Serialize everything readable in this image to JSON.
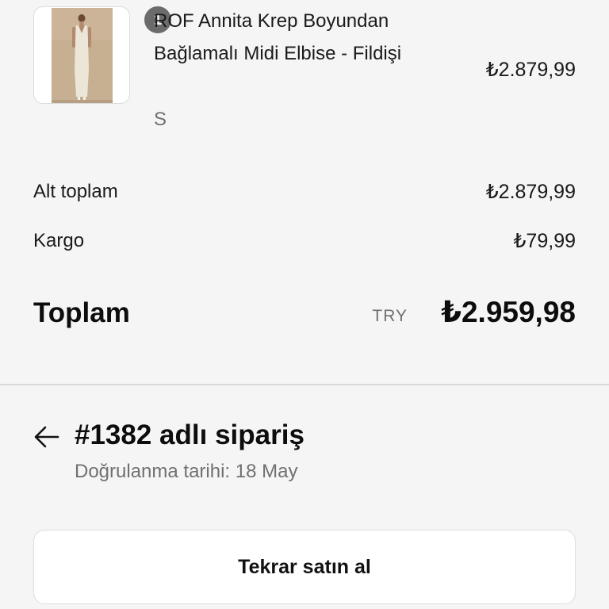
{
  "product": {
    "quantity": "1",
    "name": "ROF Annita Krep Boyundan Bağlamalı Midi Elbise - Fildişi",
    "variant": "S",
    "price": "₺2.879,99"
  },
  "summary": {
    "subtotal_label": "Alt toplam",
    "subtotal_value": "₺2.879,99",
    "shipping_label": "Kargo",
    "shipping_value": "₺79,99",
    "total_label": "Toplam",
    "currency_code": "TRY",
    "total_value": "₺2.959,98"
  },
  "order": {
    "title": "#1382 adlı sipariş",
    "confirmation_date": "Doğrulanma tarihi: 18 May",
    "back_icon": "arrow-left-icon"
  },
  "actions": {
    "rebuy_label": "Tekrar satın al"
  },
  "colors": {
    "background": "#f5f5f5",
    "text_primary": "#111111",
    "text_secondary": "#707070",
    "badge": "#6b6b6b",
    "divider": "#d9d9d9"
  }
}
